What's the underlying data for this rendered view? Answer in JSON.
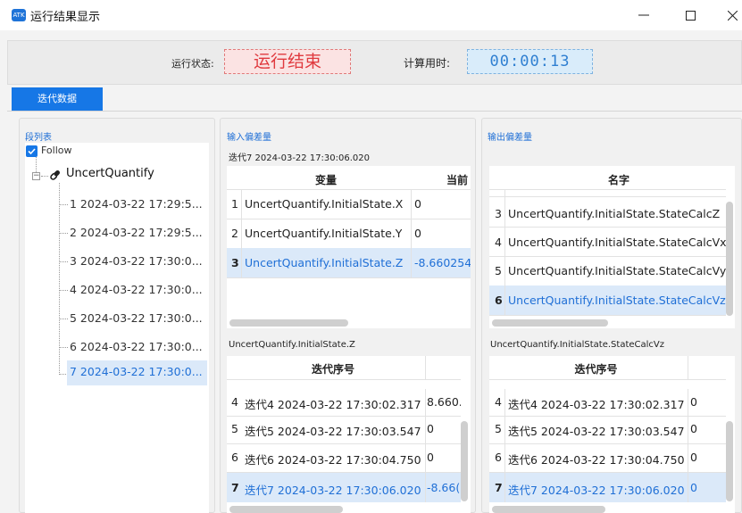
{
  "window": {
    "icon_text": "ATK",
    "title": "运行结果显示",
    "minimize_glyph": "—",
    "maximize_glyph": "☐",
    "close_glyph": "✕"
  },
  "status": {
    "state_label": "运行状态:",
    "state_value": "运行结束",
    "time_label": "计算用时:",
    "time_value": "00:00:13"
  },
  "tabs": [
    {
      "label": "迭代数据",
      "active": true
    }
  ],
  "segment_panel": {
    "title": "段列表",
    "follow_label": "Follow",
    "follow_checked": true,
    "root_label": "UncertQuantify",
    "items": [
      "1 2024-03-22 17:29:5...",
      "2 2024-03-22 17:29:5...",
      "3 2024-03-22 17:30:0...",
      "4 2024-03-22 17:30:0...",
      "5 2024-03-22 17:30:0...",
      "6 2024-03-22 17:30:0...",
      "7 2024-03-22 17:30:0..."
    ],
    "selected_index": 6
  },
  "input_panel": {
    "title": "输入偏差量",
    "iteration_label": "迭代7 2024-03-22 17:30:06.020",
    "columns": [
      "变量",
      "当前"
    ],
    "rows": [
      {
        "num": "1",
        "name": "UncertQuantify.InitialState.X",
        "value": "0"
      },
      {
        "num": "2",
        "name": "UncertQuantify.InitialState.Y",
        "value": "0"
      },
      {
        "num": "3",
        "name": "UncertQuantify.InitialState.Z",
        "value": "-8.660254"
      }
    ],
    "selected_row": 2,
    "detail_label": "UncertQuantify.InitialState.Z",
    "detail_column": "迭代序号",
    "detail_rows": [
      {
        "num": "4",
        "name": "迭代4 2024-03-22 17:30:02.317",
        "value": "8.660."
      },
      {
        "num": "5",
        "name": "迭代5 2024-03-22 17:30:03.547",
        "value": "0"
      },
      {
        "num": "6",
        "name": "迭代6 2024-03-22 17:30:04.750",
        "value": "0"
      },
      {
        "num": "7",
        "name": "迭代7 2024-03-22 17:30:06.020",
        "value": "-8.66("
      }
    ],
    "detail_selected_row": 3
  },
  "output_panel": {
    "title": "输出偏差量",
    "column": "名字",
    "rows": [
      {
        "num": "3",
        "name": "UncertQuantify.InitialState.StateCalcZ"
      },
      {
        "num": "4",
        "name": "UncertQuantify.InitialState.StateCalcVx"
      },
      {
        "num": "5",
        "name": "UncertQuantify.InitialState.StateCalcVy"
      },
      {
        "num": "6",
        "name": "UncertQuantify.InitialState.StateCalcVz"
      }
    ],
    "selected_row": 3,
    "detail_label": "UncertQuantify.InitialState.StateCalcVz",
    "detail_column": "迭代序号",
    "detail_rows": [
      {
        "num": "4",
        "name": "迭代4 2024-03-22 17:30:02.317",
        "value": "0"
      },
      {
        "num": "5",
        "name": "迭代5 2024-03-22 17:30:03.547",
        "value": "0"
      },
      {
        "num": "6",
        "name": "迭代6 2024-03-22 17:30:04.750",
        "value": "0"
      },
      {
        "num": "7",
        "name": "迭代7 2024-03-22 17:30:06.020",
        "value": "0"
      }
    ],
    "detail_selected_row": 3
  },
  "colors": {
    "accent": "#1677e6",
    "selection_bg": "#dbe9f9",
    "status_red": "#e0393e",
    "time_blue": "#2f7fd1"
  }
}
